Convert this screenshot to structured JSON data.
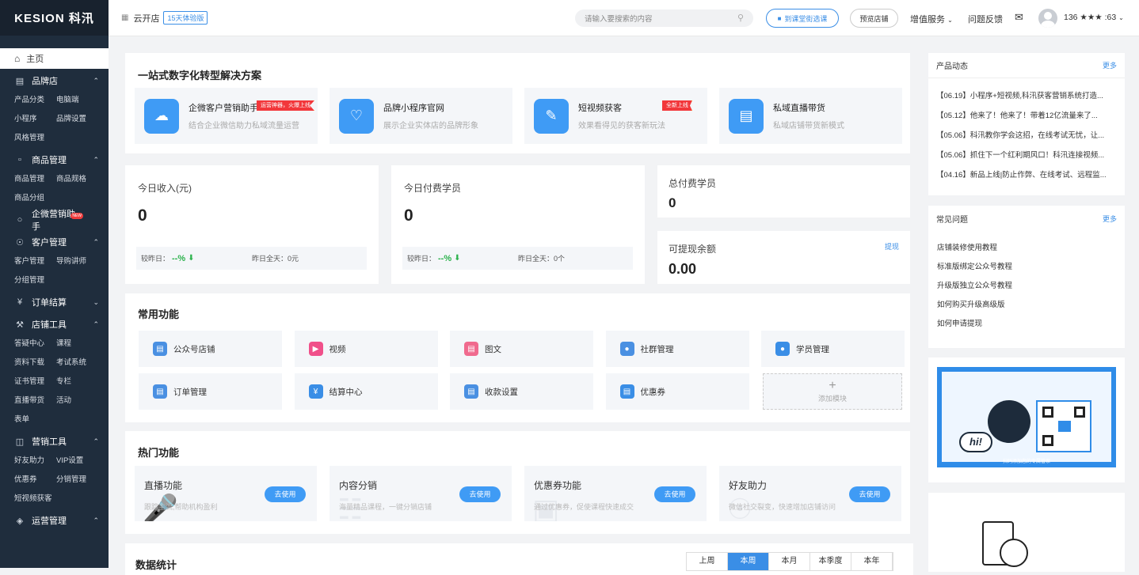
{
  "brand": {
    "logo": "KESION 科汛"
  },
  "sidebar": {
    "home": "主页",
    "sections": [
      {
        "label": "品牌店",
        "icon": "store-icon",
        "items": [
          "产品分类",
          "电脑端",
          "小程序",
          "品牌设置",
          "风格管理"
        ]
      },
      {
        "label": "商品管理",
        "icon": "bag-icon",
        "items": [
          "商品管理",
          "商品规格",
          "商品分组"
        ]
      },
      {
        "label": "企微营销助手",
        "icon": "chat-icon",
        "items": [],
        "badge": "NEW"
      },
      {
        "label": "客户管理",
        "icon": "user-icon",
        "items": [
          "客户管理",
          "导购讲师",
          "分组管理"
        ]
      },
      {
        "label": "订单结算",
        "icon": "yen-icon",
        "items": []
      },
      {
        "label": "店铺工具",
        "icon": "tools-icon",
        "items": [
          "答疑中心",
          "课程",
          "资料下载",
          "考试系统",
          "证书管理",
          "专栏",
          "直播带货",
          "活动",
          "表单"
        ]
      },
      {
        "label": "营销工具",
        "icon": "gift-icon",
        "items": [
          "好友助力",
          "VIP设置",
          "优惠券",
          "分销管理",
          "短视频获客"
        ]
      },
      {
        "label": "运营管理",
        "icon": "layers-icon",
        "items": []
      }
    ]
  },
  "topbar": {
    "shop_name": "云开店",
    "trial": "15天体验版",
    "search_placeholder": "请输入要搜索的内容",
    "course_btn": "到课堂街选课",
    "preview_btn": "预览店铺",
    "value_added": "增值服务",
    "feedback": "问题反馈",
    "user": "136 ★★★ :63"
  },
  "solutions": {
    "title": "一站式数字化转型解决方案",
    "items": [
      {
        "title": "企微客户营销助手",
        "desc": "结合企业微信助力私域流量运营",
        "tag": "运营神器，火爆上线",
        "icon": "cloud-icon"
      },
      {
        "title": "品牌小程序官网",
        "desc": "展示企业实体店的品牌形象",
        "tag": "",
        "icon": "heart-icon"
      },
      {
        "title": "短视频获客",
        "desc": "效果看得见的获客新玩法",
        "tag": "全新上线",
        "icon": "edit-icon"
      },
      {
        "title": "私域直播带货",
        "desc": "私域店铺带货新模式",
        "tag": "",
        "icon": "shop-icon"
      }
    ]
  },
  "stats": {
    "income_label": "今日收入(元)",
    "income_value": "0",
    "income_cmp": "较昨日：",
    "income_pct": "--%",
    "income_yday": "昨日全天：0元",
    "paid_label": "今日付费学员",
    "paid_value": "0",
    "paid_cmp": "较昨日：",
    "paid_pct": "--%",
    "paid_yday": "昨日全天：0个",
    "total_label": "总付费学员",
    "total_value": "0",
    "balance_label": "可提现余额",
    "balance_value": "0.00",
    "withdraw": "提现"
  },
  "common": {
    "title": "常用功能",
    "items": [
      {
        "label": "公众号店铺",
        "color": "#4a90e2",
        "icon": "wechat-store-icon"
      },
      {
        "label": "视频",
        "color": "#f0508a",
        "icon": "video-icon"
      },
      {
        "label": "图文",
        "color": "#f06a8e",
        "icon": "article-icon"
      },
      {
        "label": "社群管理",
        "color": "#4a90e2",
        "icon": "community-icon"
      },
      {
        "label": "学员管理",
        "color": "#3a8ee6",
        "icon": "student-icon"
      },
      {
        "label": "订单管理",
        "color": "#4a90e2",
        "icon": "order-icon"
      },
      {
        "label": "结算中心",
        "color": "#3a8ee6",
        "icon": "settle-icon"
      },
      {
        "label": "收款设置",
        "color": "#4a90e2",
        "icon": "wallet-icon"
      },
      {
        "label": "优惠券",
        "color": "#3a8ee6",
        "icon": "coupon-icon"
      }
    ],
    "add": "添加模块"
  },
  "hot": {
    "title": "热门功能",
    "go": "去使用",
    "items": [
      {
        "title": "直播功能",
        "desc": "跟踪主流,帮助机构盈利"
      },
      {
        "title": "内容分销",
        "desc": "海量精品课程，一键分销店铺"
      },
      {
        "title": "优惠券功能",
        "desc": "通过优惠券，促使课程快速成交"
      },
      {
        "title": "好友助力",
        "desc": "微信社交裂变，快速增加店铺访问"
      }
    ]
  },
  "data_stats": {
    "title": "数据统计",
    "tabs": [
      "上周",
      "本周",
      "本月",
      "本季度",
      "本年"
    ],
    "active": "本周"
  },
  "news": {
    "title": "产品动态",
    "more": "更多",
    "items": [
      "【06.19】小程序+短视频,科汛获客营销系统打造...",
      "【05.12】他来了！他来了！带着12亿流量来了...",
      "【05.06】科汛教你学会这招，在线考试无忧，让...",
      "【05.06】抓住下一个红利期风口！科汛连接视频...",
      "【04.16】新品上线|防止作弊、在线考试、远程监..."
    ]
  },
  "faq": {
    "title": "常见问题",
    "more": "更多",
    "items": [
      "店铺装修使用教程",
      "标准版绑定公众号教程",
      "升级版独立公众号教程",
      "如何购买升级高级版",
      "如何申请提现"
    ]
  },
  "qr": {
    "greeting": "hi!",
    "caption": "扫码添加您的专属管家"
  }
}
